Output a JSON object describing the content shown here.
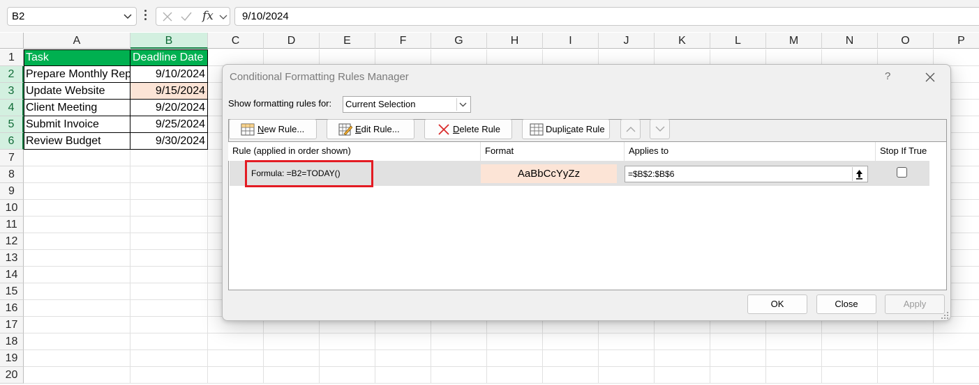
{
  "formula_bar": {
    "name_box": "B2",
    "formula": "9/10/2024",
    "fx_label": "fx"
  },
  "sheet": {
    "columns": [
      "A",
      "B",
      "C",
      "D",
      "E",
      "F",
      "G",
      "H",
      "I",
      "J",
      "K",
      "L",
      "M",
      "N",
      "O",
      "P"
    ],
    "rows": [
      "1",
      "2",
      "3",
      "4",
      "5",
      "6",
      "7",
      "8",
      "9",
      "10",
      "11",
      "12",
      "13",
      "14",
      "15",
      "16",
      "17",
      "18",
      "19",
      "20"
    ],
    "header_row": {
      "a": "Task",
      "b": "Deadline Date"
    },
    "data_rows": [
      {
        "a": "Prepare Monthly Report",
        "b": "9/10/2024"
      },
      {
        "a": "Update Website",
        "b": "9/15/2024"
      },
      {
        "a": "Client Meeting",
        "b": "9/20/2024"
      },
      {
        "a": "Submit Invoice",
        "b": "9/25/2024"
      },
      {
        "a": "Review Budget",
        "b": "9/30/2024"
      }
    ],
    "header_fill": "#00B050",
    "highlight_fill": "#FCE4D6"
  },
  "dialog": {
    "title": "Conditional Formatting Rules Manager",
    "help": "?",
    "show_rules_label": "Show formatting rules for:",
    "show_rules_value": "Current Selection",
    "buttons": {
      "new_rule": {
        "mnemonic": "N",
        "rest": "ew Rule..."
      },
      "edit_rule": {
        "mnemonic": "E",
        "rest": "dit Rule..."
      },
      "delete_rule": {
        "mnemonic": "D",
        "rest": "elete Rule"
      },
      "duplicate_rule": {
        "before": "Dupli",
        "mnemonic": "c",
        "after": "ate Rule"
      }
    },
    "list_headers": {
      "rule": "Rule (applied in order shown)",
      "format": "Format",
      "applies_to": "Applies to",
      "stop_if_true": "Stop If True"
    },
    "rule": {
      "formula": "Formula: =B2=TODAY()",
      "format_preview": "AaBbCcYyZz",
      "applies_to": "=$B$2:$B$6",
      "stop_if_true": false
    },
    "footer": {
      "ok": "OK",
      "close": "Close",
      "apply": "Apply"
    },
    "highlight_color": "#E31B23"
  }
}
